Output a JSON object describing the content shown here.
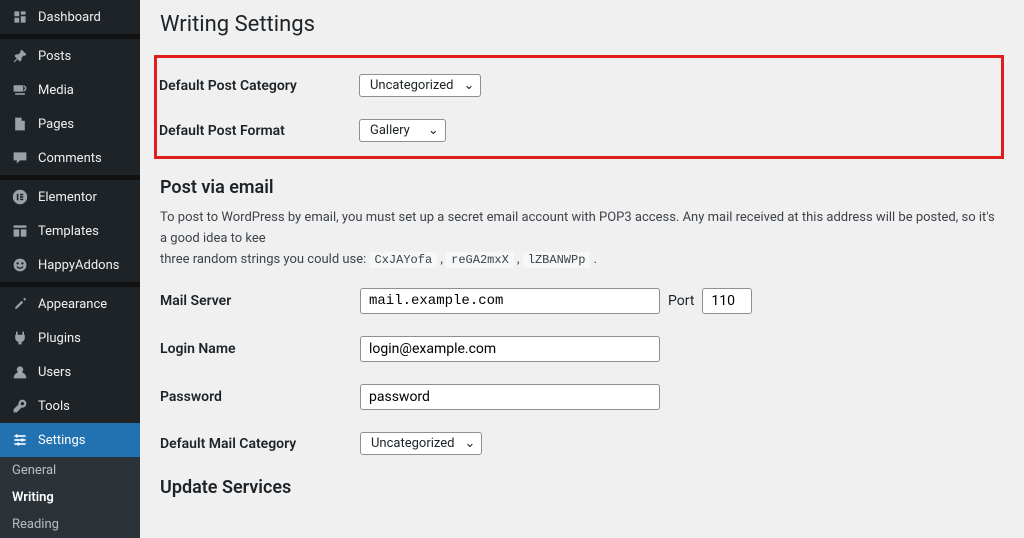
{
  "sidebar": {
    "items": [
      {
        "label": "Dashboard"
      },
      {
        "label": "Posts"
      },
      {
        "label": "Media"
      },
      {
        "label": "Pages"
      },
      {
        "label": "Comments"
      },
      {
        "label": "Elementor"
      },
      {
        "label": "Templates"
      },
      {
        "label": "HappyAddons"
      },
      {
        "label": "Appearance"
      },
      {
        "label": "Plugins"
      },
      {
        "label": "Users"
      },
      {
        "label": "Tools"
      },
      {
        "label": "Settings"
      }
    ],
    "submenu": [
      {
        "label": "General"
      },
      {
        "label": "Writing"
      },
      {
        "label": "Reading"
      }
    ]
  },
  "page": {
    "title": "Writing Settings",
    "section_post_via_email": "Post via email",
    "section_update_services": "Update Services"
  },
  "form": {
    "default_category_label": "Default Post Category",
    "default_category_value": "Uncategorized",
    "default_format_label": "Default Post Format",
    "default_format_value": "Gallery",
    "mail_server_label": "Mail Server",
    "mail_server_value": "mail.example.com",
    "port_label": "Port",
    "port_value": "110",
    "login_label": "Login Name",
    "login_value": "login@example.com",
    "password_label": "Password",
    "password_value": "password",
    "default_mail_category_label": "Default Mail Category",
    "default_mail_category_value": "Uncategorized"
  },
  "desc": {
    "pre": "To post to WordPress by email, you must set up a secret email account with POP3 access. Any mail received at this address will be posted, so it's a good idea to kee",
    "mid": "three random strings you could use:  ",
    "c1": "CxJAYofa",
    "c2": "reGA2mxX",
    "c3": "lZBANWPp",
    "comma": " ,  ",
    "period": " ."
  }
}
